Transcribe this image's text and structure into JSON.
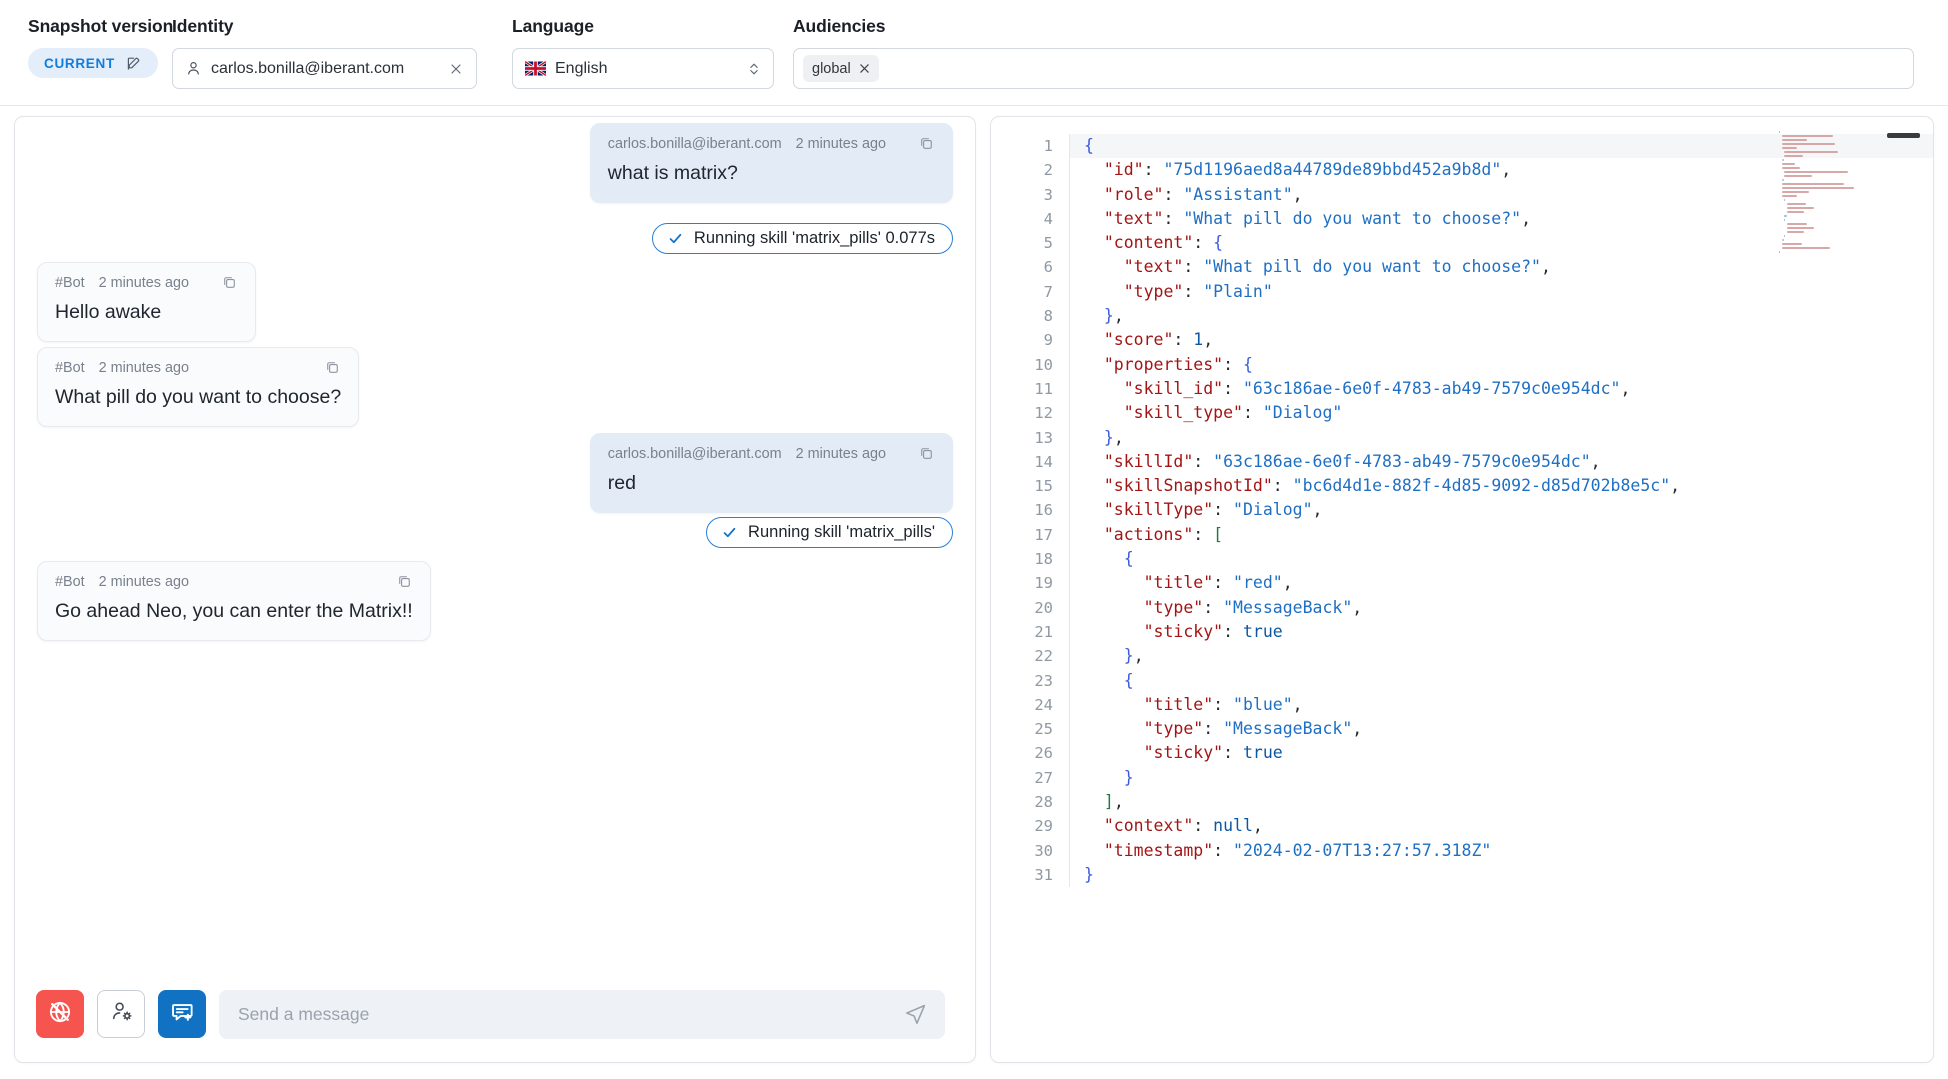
{
  "topbar": {
    "snapshot": {
      "label": "Snapshot version",
      "badge_text": "CURRENT",
      "edit_icon": "pencil-square-icon"
    },
    "identity": {
      "label": "Identity",
      "value": "carlos.bonilla@iberant.com",
      "placeholder": "Identity",
      "user_icon": "user-icon",
      "clear_icon": "close-icon"
    },
    "language": {
      "label": "Language",
      "value": "English",
      "flag_icon": "uk-flag-icon",
      "chevron_icon": "chevron-up-down-icon"
    },
    "audiences": {
      "label": "Audiencies",
      "chips": [
        {
          "label": "global",
          "remove_icon": "close-icon"
        }
      ]
    }
  },
  "chat": {
    "messages": [
      {
        "side": "right",
        "kind": "user",
        "author": "carlos.bonilla@iberant.com",
        "time": "2 minutes ago",
        "text": "what is matrix?",
        "copy_icon": "copy-icon"
      },
      {
        "side": "right",
        "kind": "pill",
        "text": "Running skill 'matrix_pills' 0.077s",
        "icon": "check-icon"
      },
      {
        "side": "left",
        "kind": "bot",
        "author": "#Bot",
        "time": "2 minutes ago",
        "text": "Hello awake",
        "copy_icon": "copy-icon"
      },
      {
        "side": "left",
        "kind": "bot",
        "author": "#Bot",
        "time": "2 minutes ago",
        "text": "What pill do you want to choose?",
        "copy_icon": "copy-icon"
      },
      {
        "side": "right",
        "kind": "user",
        "author": "carlos.bonilla@iberant.com",
        "time": "2 minutes ago",
        "text": "red",
        "copy_icon": "copy-icon"
      },
      {
        "side": "right",
        "kind": "pill",
        "text": "Running skill 'matrix_pills'",
        "icon": "check-icon"
      },
      {
        "side": "left",
        "kind": "bot",
        "author": "#Bot",
        "time": "2 minutes ago",
        "text": "Go ahead Neo, you can enter the Matrix!!",
        "copy_icon": "copy-icon"
      }
    ],
    "composer": {
      "buttons": [
        {
          "name": "globe-off-icon",
          "style": "red"
        },
        {
          "name": "user-settings-icon",
          "style": "ghost"
        },
        {
          "name": "new-chat-icon",
          "style": "blue"
        }
      ],
      "input_placeholder": "Send a message",
      "input_value": "",
      "send_icon": "send-icon"
    }
  },
  "code": {
    "json_text": "{\n  \"id\": \"75d1196aed8a44789de89bbd452a9b8d\",\n  \"role\": \"Assistant\",\n  \"text\": \"What pill do you want to choose?\",\n  \"content\": {\n    \"text\": \"What pill do you want to choose?\",\n    \"type\": \"Plain\"\n  },\n  \"score\": 1,\n  \"properties\": {\n    \"skill_id\": \"63c186ae-6e0f-4783-ab49-7579c0e954dc\",\n    \"skill_type\": \"Dialog\"\n  },\n  \"skillId\": \"63c186ae-6e0f-4783-ab49-7579c0e954dc\",\n  \"skillSnapshotId\": \"bc6d4d1e-882f-4d85-9092-d85d702b8e5c\",\n  \"skillType\": \"Dialog\",\n  \"actions\": [\n    {\n      \"title\": \"red\",\n      \"type\": \"MessageBack\",\n      \"sticky\": true\n    },\n    {\n      \"title\": \"blue\",\n      \"type\": \"MessageBack\",\n      \"sticky\": true\n    }\n  ],\n  \"context\": null,\n  \"timestamp\": \"2024-02-07T13:27:57.318Z\"\n}",
    "first_line_number": 1,
    "last_line_number": 31,
    "active_line": 1,
    "minimap_visible": true
  },
  "colors": {
    "accent_blue": "#1172c4",
    "badge_blue": "#0f7ddb",
    "danger_red": "#f5544f",
    "user_bubble": "#e3ecf6",
    "bot_bubble": "#fafbfc",
    "key_color": "#a31515",
    "string_color": "#1f6fc4"
  }
}
